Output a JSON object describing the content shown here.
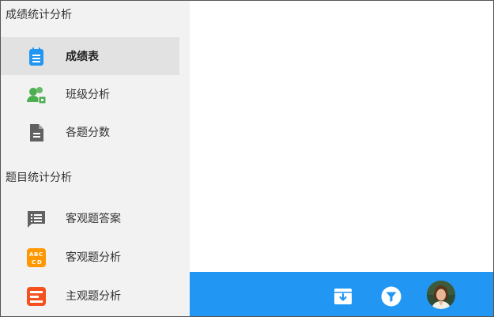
{
  "sidebar": {
    "sections": [
      {
        "title": "成绩统计分析"
      },
      {
        "title": "题目统计分析"
      }
    ],
    "items": [
      {
        "label": "成绩表",
        "icon": "notepad-icon",
        "active": true
      },
      {
        "label": "班级分析",
        "icon": "users-icon"
      },
      {
        "label": "各题分数",
        "icon": "document-icon"
      },
      {
        "label": "客观题答案",
        "icon": "list-comment-icon"
      },
      {
        "label": "客观题分析",
        "icon": "abcd-icon"
      },
      {
        "label": "主观题分析",
        "icon": "form-lines-icon"
      }
    ]
  },
  "bottombar": {
    "color": "#2196f3",
    "buttons": [
      {
        "icon": "archive-download-icon"
      },
      {
        "icon": "filter-icon"
      }
    ]
  }
}
